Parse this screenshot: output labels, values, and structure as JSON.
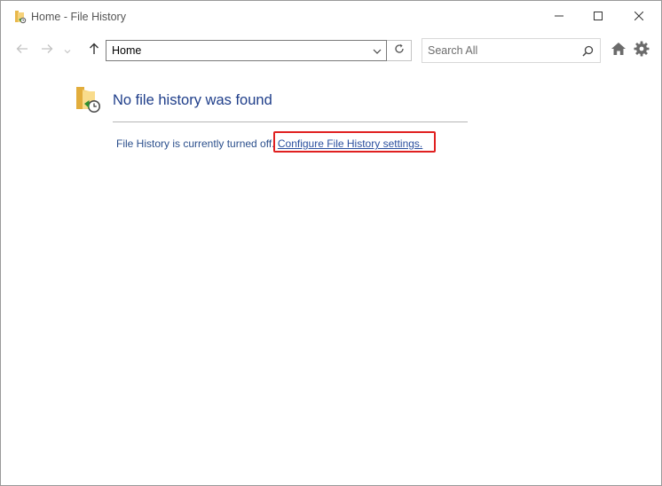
{
  "window": {
    "title": "Home - File History",
    "icon": "file-history-folder-icon"
  },
  "controls": {
    "minimize_icon": "minimize-icon",
    "maximize_icon": "maximize-icon",
    "close_icon": "close-icon"
  },
  "nav": {
    "back_icon": "arrow-left-icon",
    "forward_icon": "arrow-right-icon",
    "recent_icon": "chevron-down-icon",
    "up_icon": "arrow-up-icon",
    "address_value": "Home",
    "refresh_icon": "refresh-icon",
    "search_placeholder": "Search All",
    "home_icon": "home-icon",
    "settings_icon": "gear-icon"
  },
  "main": {
    "heading": "No file history was found",
    "status_text": "File History is currently turned off.",
    "configure_link": "Configure File History settings."
  },
  "colors": {
    "heading": "#1f3e8a",
    "link": "#2a4f9e",
    "highlight": "#e02020"
  }
}
